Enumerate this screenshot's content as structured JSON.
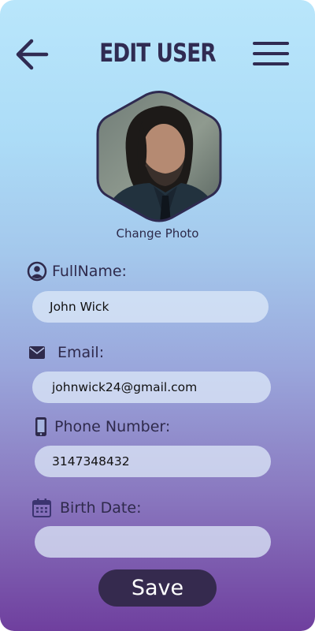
{
  "header": {
    "title": "EDIT USER",
    "back_icon": "arrow-left-icon",
    "menu_icon": "hamburger-menu-icon"
  },
  "profile": {
    "change_photo_label": "Change Photo"
  },
  "form": {
    "fullname": {
      "label": "FullName:",
      "value": "John Wick",
      "icon": "user-circle-icon"
    },
    "email": {
      "label": "Email:",
      "value": "johnwick24@gmail.com",
      "icon": "envelope-icon"
    },
    "phone": {
      "label": "Phone Number:",
      "value": "3147348432",
      "icon": "mobile-phone-icon"
    },
    "birthdate": {
      "label": "Birth Date:",
      "value": "",
      "icon": "calendar-icon"
    }
  },
  "actions": {
    "save_label": "Save"
  },
  "colors": {
    "text_dark": "#302b52",
    "save_button": "#352a4e",
    "field_bg": "#deeaf8"
  }
}
